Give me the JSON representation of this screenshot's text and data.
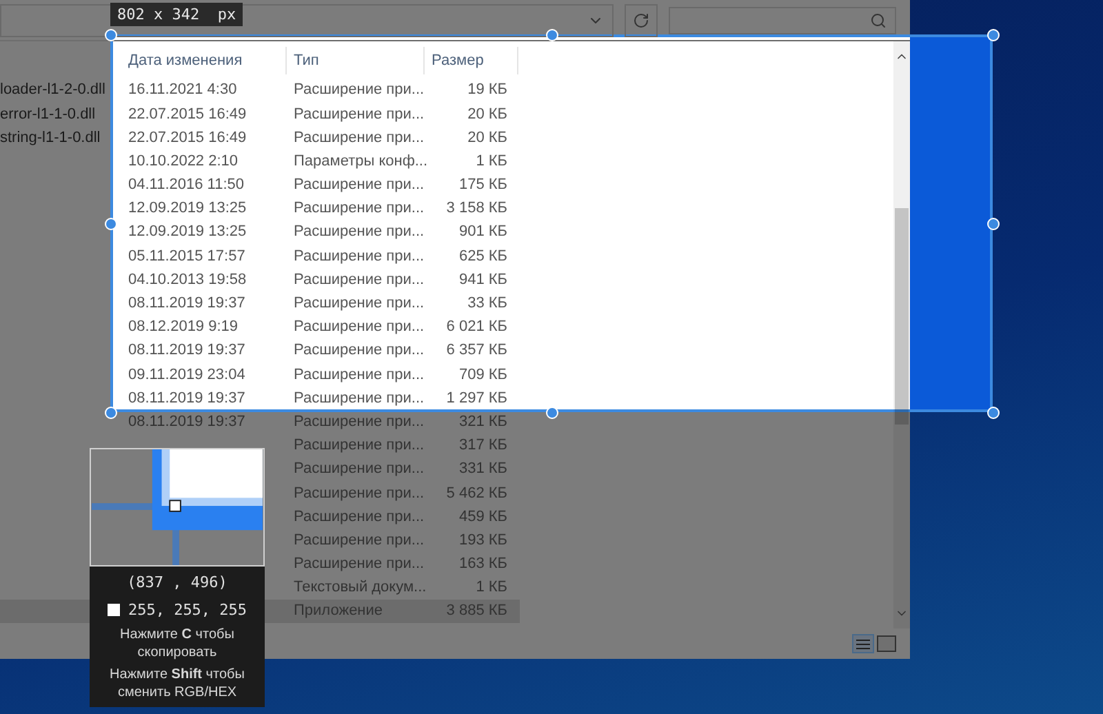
{
  "explorer": {
    "columns": [
      {
        "label": "Дата изменения"
      },
      {
        "label": "Тип"
      },
      {
        "label": "Размер"
      }
    ],
    "rows": [
      {
        "name": "loader-l1-2-0.dll",
        "date": "16.11.2021 4:30",
        "type": "Расширение при...",
        "size": "19 КБ",
        "selected": false
      },
      {
        "name": "error-l1-1-0.dll",
        "date": "22.07.2015 16:49",
        "type": "Расширение при...",
        "size": "20 КБ",
        "selected": false
      },
      {
        "name": "string-l1-1-0.dll",
        "date": "22.07.2015 16:49",
        "type": "Расширение при...",
        "size": "20 КБ",
        "selected": false
      },
      {
        "date": "10.10.2022 2:10",
        "type": "Параметры конф...",
        "size": "1 КБ",
        "selected": false
      },
      {
        "date": "04.11.2016 11:50",
        "type": "Расширение при...",
        "size": "175 КБ",
        "selected": false
      },
      {
        "date": "12.09.2019 13:25",
        "type": "Расширение при...",
        "size": "3 158 КБ",
        "selected": false
      },
      {
        "date": "12.09.2019 13:25",
        "type": "Расширение при...",
        "size": "901 КБ",
        "selected": false
      },
      {
        "date": "05.11.2015 17:57",
        "type": "Расширение при...",
        "size": "625 КБ",
        "selected": false
      },
      {
        "date": "04.10.2013 19:58",
        "type": "Расширение при...",
        "size": "941 КБ",
        "selected": false
      },
      {
        "date": "08.11.2019 19:37",
        "type": "Расширение при...",
        "size": "33 КБ",
        "selected": false
      },
      {
        "date": "08.12.2019 9:19",
        "type": "Расширение при...",
        "size": "6 021 КБ",
        "selected": false
      },
      {
        "date": "08.11.2019 19:37",
        "type": "Расширение при...",
        "size": "6 357 КБ",
        "selected": false
      },
      {
        "date": "09.11.2019 23:04",
        "type": "Расширение при...",
        "size": "709 КБ",
        "selected": false
      },
      {
        "date": "08.11.2019 19:37",
        "type": "Расширение при...",
        "size": "1 297 КБ",
        "selected": false
      },
      {
        "date": "08.11.2019 19:37",
        "type": "Расширение при...",
        "size": "321 КБ",
        "selected": false
      },
      {
        "type": "Расширение при...",
        "size": "317 КБ",
        "selected": false
      },
      {
        "type": "Расширение при...",
        "size": "331 КБ",
        "selected": false
      },
      {
        "type": "Расширение при...",
        "size": "5 462 КБ",
        "selected": false
      },
      {
        "type": "Расширение при...",
        "size": "459 КБ",
        "selected": false
      },
      {
        "type": "Расширение при...",
        "size": "193 КБ",
        "selected": false
      },
      {
        "type": "Расширение при...",
        "size": "163 КБ",
        "selected": false
      },
      {
        "type": "Текстовый докум...",
        "size": "1 КБ",
        "selected": false
      },
      {
        "type": "Приложение",
        "size": "3 885 КБ",
        "selected": true
      }
    ]
  },
  "capture": {
    "size_label": "802 x 342  px"
  },
  "magnifier": {
    "coordinates": "(837 , 496)",
    "color_value": "255, 255, 255",
    "hints": [
      "Нажмите **C** чтобы скопировать",
      "Нажмите **Shift** чтобы сменить RGB/HEX"
    ]
  }
}
